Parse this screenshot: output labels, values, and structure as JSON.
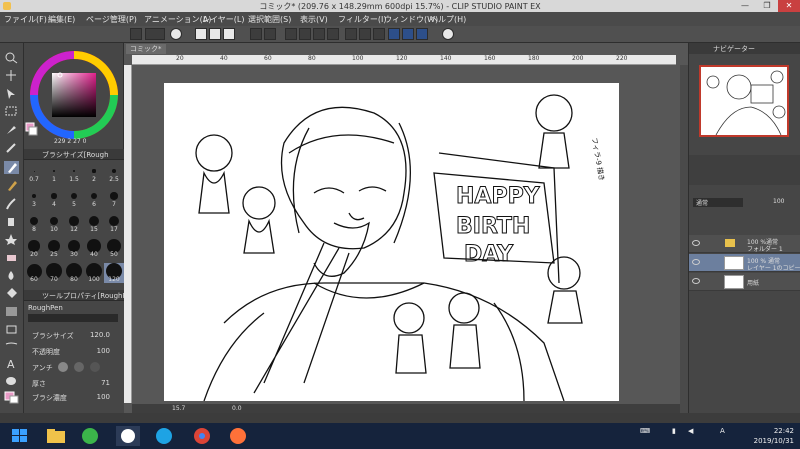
{
  "window": {
    "title": "コミック* (209.76 x 148.29mm 600dpi 15.7%)  - CLIP STUDIO PAINT EX",
    "minimize": "—",
    "maximize": "❐",
    "close": "✕"
  },
  "menu": [
    "ファイル(F)",
    "編集(E)",
    "ページ管理(P)",
    "アニメーション(A)",
    "レイヤー(L)",
    "選択範囲(S)",
    "表示(V)",
    "フィルター(I)",
    "ウィンドウ(W)",
    "ヘルプ(H)"
  ],
  "canvas": {
    "doc_tab": "コミック*",
    "ruler_ticks": [
      "20",
      "40",
      "60",
      "80",
      "100",
      "120",
      "140",
      "160",
      "180",
      "200",
      "220"
    ],
    "zoom": "15.7",
    "angle": "0.0",
    "drawing_text": [
      "HAPPY",
      "BIRTH",
      "DAY"
    ],
    "corner_note": "フィラ-9 描き"
  },
  "color_panel": {
    "values": "229  2  27  0"
  },
  "brush_size_panel": {
    "title": "ブラシサイズ[Rough",
    "sizes": [
      "0.7",
      "1",
      "1.5",
      "2",
      "2.5",
      "3",
      "4",
      "5",
      "6",
      "7",
      "8",
      "10",
      "12",
      "15",
      "17",
      "20",
      "25",
      "30",
      "40",
      "50",
      "60",
      "70",
      "80",
      "100",
      "120"
    ]
  },
  "tool_property": {
    "title": "ツールプロパティ[RoughPe",
    "brush_name": "RoughPen",
    "rows": [
      {
        "label": "ブラシサイズ",
        "value": "120.0"
      },
      {
        "label": "不透明度",
        "value": "100"
      },
      {
        "label": "アンチ",
        "value": ""
      },
      {
        "label": "厚さ",
        "value": "71"
      },
      {
        "label": "ブラシ濃度",
        "value": "100"
      }
    ]
  },
  "navigator": {
    "title": "ナビゲーター"
  },
  "layer_panel": {
    "blend_mode": "通常",
    "opacity": "100",
    "layers": [
      {
        "line1": "100 %通常",
        "line2": "フォルダー 1"
      },
      {
        "line1": "100 % 通常",
        "line2": "レイヤー 1のコピー"
      },
      {
        "line1": "",
        "line2": "用紙"
      }
    ]
  },
  "taskbar": {
    "time": "22:42",
    "date": "2019/10/31",
    "ime": "A"
  },
  "colors": {
    "taskbar": "#15233c",
    "ui_dark": "#464646",
    "navigator_frame": "#c0392b",
    "selected_layer": "#6c7f9e"
  }
}
